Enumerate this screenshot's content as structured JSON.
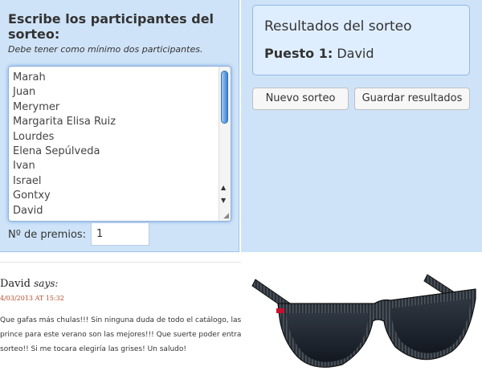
{
  "participants": {
    "title": "Escribe los participantes del sorteo:",
    "note": "Debe tener como mínimo dos participantes.",
    "names": [
      "Marah",
      "Juan",
      "Merymer",
      "Margarita Elisa Ruiz",
      "Lourdes",
      "Elena Sepúlveda",
      "Ivan",
      "Israel",
      "Gontxy",
      "David"
    ],
    "prizes_label": "Nº de premios:",
    "prizes_value": "1"
  },
  "results": {
    "title": "Resultados del sorteo",
    "position_label": "Puesto 1:",
    "winner": "David",
    "new_button": "Nuevo sorteo",
    "save_button": "Guardar resultados"
  },
  "comment": {
    "author": "David",
    "says": "says:",
    "date": "4/03/2013 AT 15:32",
    "lines": [
      "Que gafas más chulas!!! Sin ninguna duda de todo el catálogo, las ice",
      "prince para este verano son las mejores!!! Que suerte poder entrar en",
      "sorteo!! Si me tocara elegiría las grises! Un saludo!"
    ]
  },
  "colors": {
    "panel_bg": "#cfe3f8",
    "results_bg": "#dfeeff",
    "date_red": "#b34a2a",
    "scroll_blue": "#3b82d5"
  }
}
